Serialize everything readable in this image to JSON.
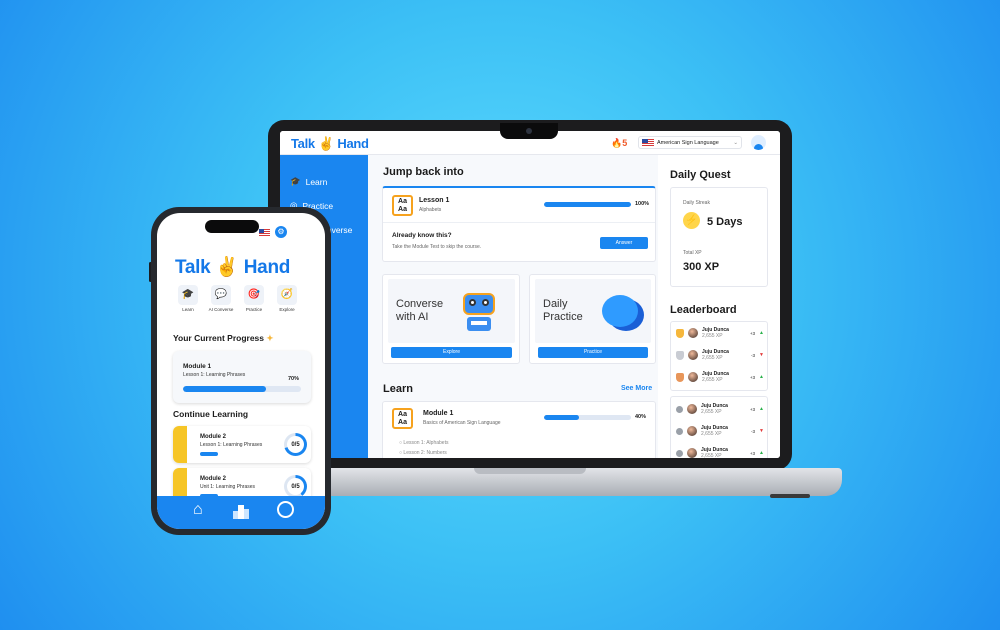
{
  "brand": {
    "word1": "Talk",
    "word2": "Hand"
  },
  "colors": {
    "accent": "#1a86f0",
    "brand_yellow": "#f6b73c",
    "background": "#3cc0f5"
  },
  "desktop": {
    "topbar": {
      "streak_count": "5",
      "language": "American Sign Language"
    },
    "sidebar": {
      "items": [
        {
          "label": "Learn",
          "icon": "graduation-cap-icon"
        },
        {
          "label": "Practice",
          "icon": "target-icon"
        },
        {
          "label": "AI Converse",
          "icon": "chat-icon"
        }
      ]
    },
    "jump_back": {
      "heading": "Jump back into",
      "lesson_title": "Lesson 1",
      "lesson_subtitle": "Alphabets",
      "progress_label": "100%",
      "progress": 1.0,
      "prompt_title": "Already know this?",
      "prompt_text": "Take the Module Test to skip the course.",
      "answer_button": "Answer"
    },
    "feature_cards": [
      {
        "title_line1": "Converse",
        "title_line2": "with AI",
        "button": "Explore"
      },
      {
        "title_line1": "Daily",
        "title_line2": "Practice",
        "button": "Practice"
      }
    ],
    "learn": {
      "heading": "Learn",
      "see_more": "See More",
      "module_title": "Module 1",
      "module_subtitle": "Basics of American Sign Language",
      "progress_label": "40%",
      "progress": 0.4,
      "lessons": [
        "Lesson 1: Alphabets",
        "Lesson 2: Numbers"
      ]
    },
    "daily_quest": {
      "heading": "Daily Quest",
      "streak_label": "Daily Streak",
      "streak_value": "5 Days",
      "xp_label": "Total XP",
      "xp_value": "300 XP"
    },
    "leaderboard": {
      "heading": "Leaderboard",
      "rows": [
        {
          "name": "Juju Dunca",
          "xp": "2,655 XP",
          "delta": "+3",
          "dir": "up"
        },
        {
          "name": "Juju Dunca",
          "xp": "2,655 XP",
          "delta": "-3",
          "dir": "down"
        },
        {
          "name": "Juju Dunca",
          "xp": "2,655 XP",
          "delta": "+3",
          "dir": "up"
        },
        {
          "name": "Juju Dunca",
          "xp": "2,655 XP",
          "delta": "+3",
          "dir": "up"
        },
        {
          "name": "Juju Dunca",
          "xp": "2,655 XP",
          "delta": "-3",
          "dir": "down"
        },
        {
          "name": "Juju Dunca",
          "xp": "2,655 XP",
          "delta": "+3",
          "dir": "up"
        }
      ]
    }
  },
  "mobile": {
    "quick_actions": [
      {
        "label": "Learn",
        "icon": "graduation-cap-icon"
      },
      {
        "label": "AI Converse",
        "icon": "chat-icon"
      },
      {
        "label": "Practice",
        "icon": "target-icon"
      },
      {
        "label": "Explore",
        "icon": "compass-icon"
      }
    ],
    "progress_heading": "Your Current Progress",
    "current": {
      "module": "Module 1",
      "lesson": "Lesson 1: Learning Phrases",
      "percent_label": "70%",
      "progress": 0.7
    },
    "continue_heading": "Continue Learning",
    "continue_items": [
      {
        "module": "Module 2",
        "lesson": "Lesson 1: Learning Phrases",
        "count": "0/5",
        "ring_progress": 0.7
      },
      {
        "module": "Module 2",
        "lesson": "Unit 1: Learning Phrases",
        "count": "0/5",
        "ring_progress": 0.4
      }
    ],
    "tabbar": [
      "home-icon",
      "leaderboard-icon",
      "profile-icon"
    ]
  }
}
